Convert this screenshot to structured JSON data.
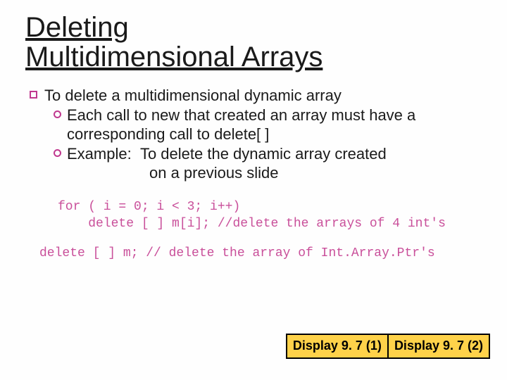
{
  "title_line1": "Deleting",
  "title_line2": "Multidimensional Arrays",
  "bullet_main": "To delete a multidimensional dynamic array",
  "sub1": "Each call to new that created an array must have a corresponding call to delete[ ]",
  "sub2_label": "Example:",
  "sub2_rest": "To delete the dynamic array created",
  "sub2_line2": "on a previous slide",
  "code_block1_l1": "for ( i = 0; i < 3; i++)",
  "code_block1_l2": "    delete [ ] m[i]; //delete the arrays of 4 int's",
  "code_block2": "delete [ ] m; // delete the array of Int.Array.Ptr's",
  "buttons": {
    "b1": "Display 9. 7 (1)",
    "b2": "Display 9. 7 (2)"
  }
}
